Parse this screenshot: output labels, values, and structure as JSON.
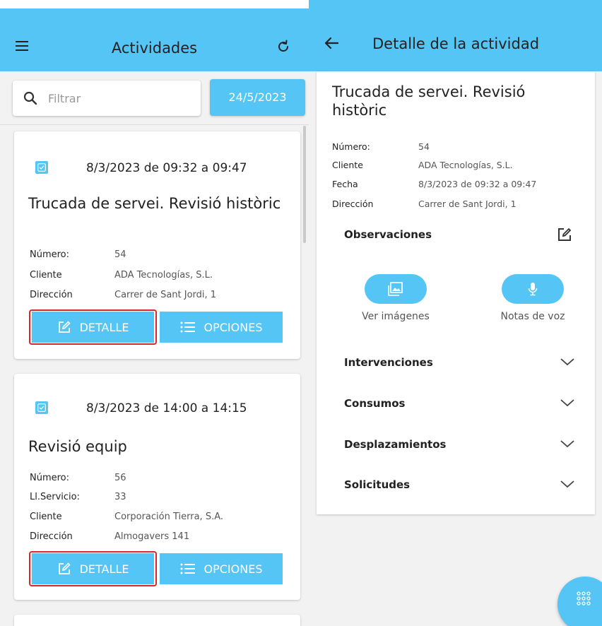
{
  "list_screen": {
    "title": "Actividades",
    "filter_placeholder": "Filtrar",
    "date_button": "24/5/2023",
    "cards": [
      {
        "datetime": "8/3/2023 de 09:32 a 09:47",
        "title": "Trucada de servei. Revisió històric",
        "fields": [
          {
            "label": "Número:",
            "value": "54"
          },
          {
            "label": "Cliente",
            "value": "ADA Tecnologías, S.L."
          },
          {
            "label": "Dirección",
            "value": "Carrer de Sant Jordi, 1"
          }
        ],
        "detail_label": "DETALLE",
        "options_label": "OPCIONES"
      },
      {
        "datetime": "8/3/2023 de 14:00 a 14:15",
        "title": "Revisió equip",
        "fields": [
          {
            "label": "Número:",
            "value": "56"
          },
          {
            "label": "Ll.Servicio:",
            "value": "33"
          },
          {
            "label": "Cliente",
            "value": "Corporación Tierra, S.A."
          },
          {
            "label": "Dirección",
            "value": "Almogavers 141"
          }
        ],
        "detail_label": "DETALLE",
        "options_label": "OPCIONES"
      }
    ]
  },
  "detail_screen": {
    "title": "Detalle de la actividad",
    "activity_title": "Trucada de servei. Revisió històric",
    "fields": [
      {
        "label": "Número:",
        "value": "54"
      },
      {
        "label": "Cliente",
        "value": "ADA Tecnologías, S.L."
      },
      {
        "label": "Fecha",
        "value": "8/3/2023 de 09:32 a 09:47"
      },
      {
        "label": "Dirección",
        "value": "Carrer de Sant Jordi, 1"
      }
    ],
    "observations_label": "Observaciones",
    "images_label": "Ver imágenes",
    "voice_label": "Notas de voz",
    "sections": [
      "Intervenciones",
      "Consumos",
      "Desplazamientos",
      "Solicitudes"
    ]
  },
  "icons": {
    "menu": "menu-icon",
    "refresh": "refresh-icon",
    "search": "search-icon",
    "check": "checkbox-icon",
    "edit": "edit-icon",
    "list": "list-icon",
    "back": "back-arrow-icon",
    "image": "image-icon",
    "mic": "microphone-icon",
    "chevron": "chevron-down-icon",
    "grid": "grid-dots-icon"
  },
  "colors": {
    "accent": "#54c5f5",
    "highlight": "#d9262c",
    "background": "#f2f2f2"
  }
}
